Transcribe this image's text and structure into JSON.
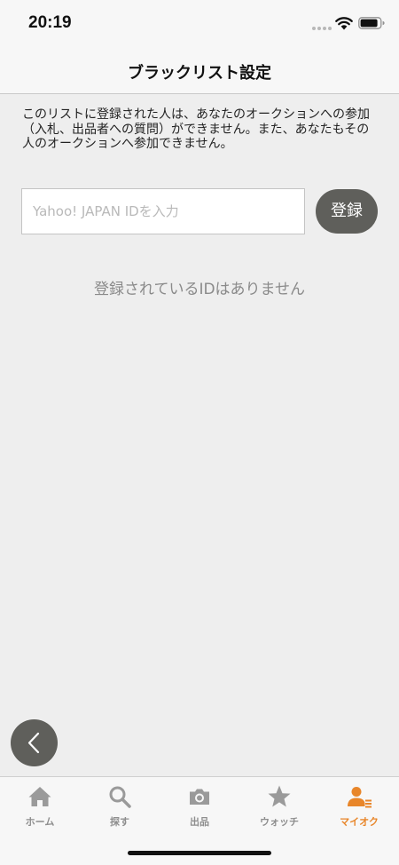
{
  "status_bar": {
    "time": "20:19"
  },
  "nav": {
    "title": "ブラックリスト設定"
  },
  "description": "このリストに登録された人は、あなたのオークションへの参加（入札、出品者への質問）ができません。また、あなたもその人のオークションへ参加できません。",
  "form": {
    "id_placeholder": "Yahoo! JAPAN IDを入力",
    "id_value": "",
    "register_label": "登録"
  },
  "empty_message": "登録されているIDはありません",
  "tab_bar": {
    "items": [
      {
        "label": "ホーム",
        "icon": "home-icon",
        "active": false
      },
      {
        "label": "探す",
        "icon": "search-icon",
        "active": false
      },
      {
        "label": "出品",
        "icon": "camera-icon",
        "active": false
      },
      {
        "label": "ウォッチ",
        "icon": "star-icon",
        "active": false
      },
      {
        "label": "マイオク",
        "icon": "my-auction-icon",
        "active": true
      }
    ]
  },
  "colors": {
    "accent": "#e8862a",
    "button": "#5f5f5b",
    "background": "#eeeeee",
    "inactive_tab": "#8e8e8e"
  }
}
